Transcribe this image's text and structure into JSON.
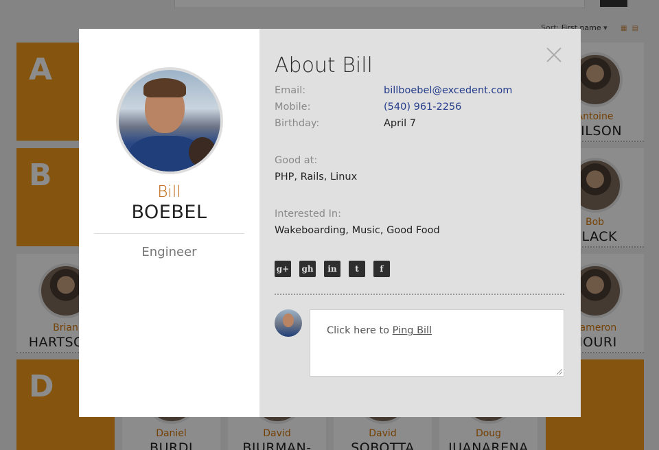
{
  "background": {
    "sort_prefix": "Sort: ",
    "sort_value": "First name",
    "sort_chevron": "▾",
    "view_icons": "▦ ▤",
    "letters": [
      "A",
      "B",
      "D"
    ],
    "people": [
      {
        "first": "Antoine",
        "last": "WILSON"
      },
      {
        "first": "Bob",
        "last": "BLACK"
      },
      {
        "first": "Brian",
        "last": "HARTSOCK"
      },
      {
        "first": "Cameron",
        "last": "NOURI"
      },
      {
        "first": "Daniel",
        "last": "BURDI"
      },
      {
        "first": "David",
        "last": "BJURMAN-"
      },
      {
        "first": "David",
        "last": "SOBOTTA"
      },
      {
        "first": "Doug",
        "last": "JUANARENA"
      }
    ]
  },
  "modal": {
    "first_name": "Bill",
    "last_name": "BOEBEL",
    "job_title": "Engineer",
    "about_title": "About Bill",
    "contact": {
      "email_label": "Email:",
      "email": "billboebel@excedent.com",
      "mobile_label": "Mobile:",
      "mobile": "(540) 961-2256",
      "birthday_label": "Birthday:",
      "birthday": "April 7"
    },
    "good_at_label": "Good at:",
    "good_at": "PHP, Rails, Linux",
    "interested_label": "Interested In:",
    "interested": "Wakeboarding, Music, Good Food",
    "socials": {
      "googleplus": "g+",
      "github": "gh",
      "linkedin": "in",
      "twitter": "t",
      "facebook": "f"
    },
    "ping": {
      "prefix": "Click here to ",
      "link": "Ping Bill"
    }
  },
  "colors": {
    "accent_orange": "#f29a1c",
    "first_name_brown": "#b9600a",
    "link_blue": "#233b8a"
  }
}
